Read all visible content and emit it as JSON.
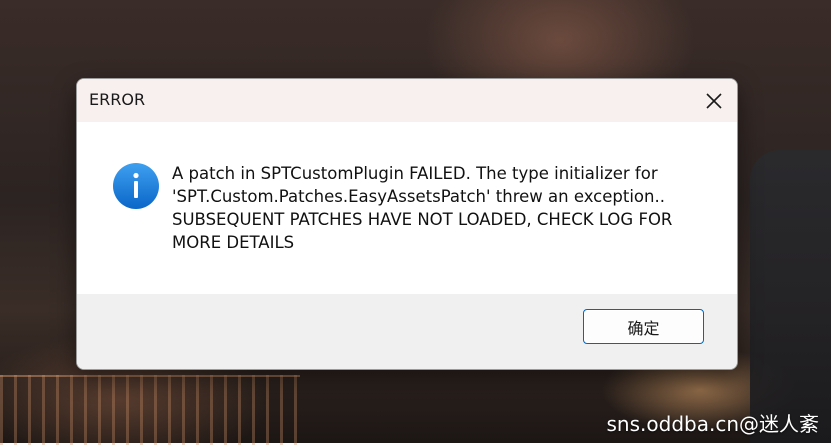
{
  "dialog": {
    "title": "ERROR",
    "message": "A patch in SPTCustomPlugin FAILED. The type initializer for\n'SPT.Custom.Patches.EasyAssetsPatch' threw an exception..\nSUBSEQUENT PATCHES HAVE NOT LOADED, CHECK LOG FOR\nMORE DETAILS",
    "ok_label": "确定",
    "close_icon": "close-icon",
    "status_icon": "info-icon"
  },
  "watermark": {
    "text": "sns.oddba.cn@迷人紊"
  },
  "colors": {
    "accent": "#0067c0",
    "titlebar_bg": "#f8f0ee",
    "footer_bg": "#f0f0f0",
    "info_icon": "#1a7fd8"
  }
}
